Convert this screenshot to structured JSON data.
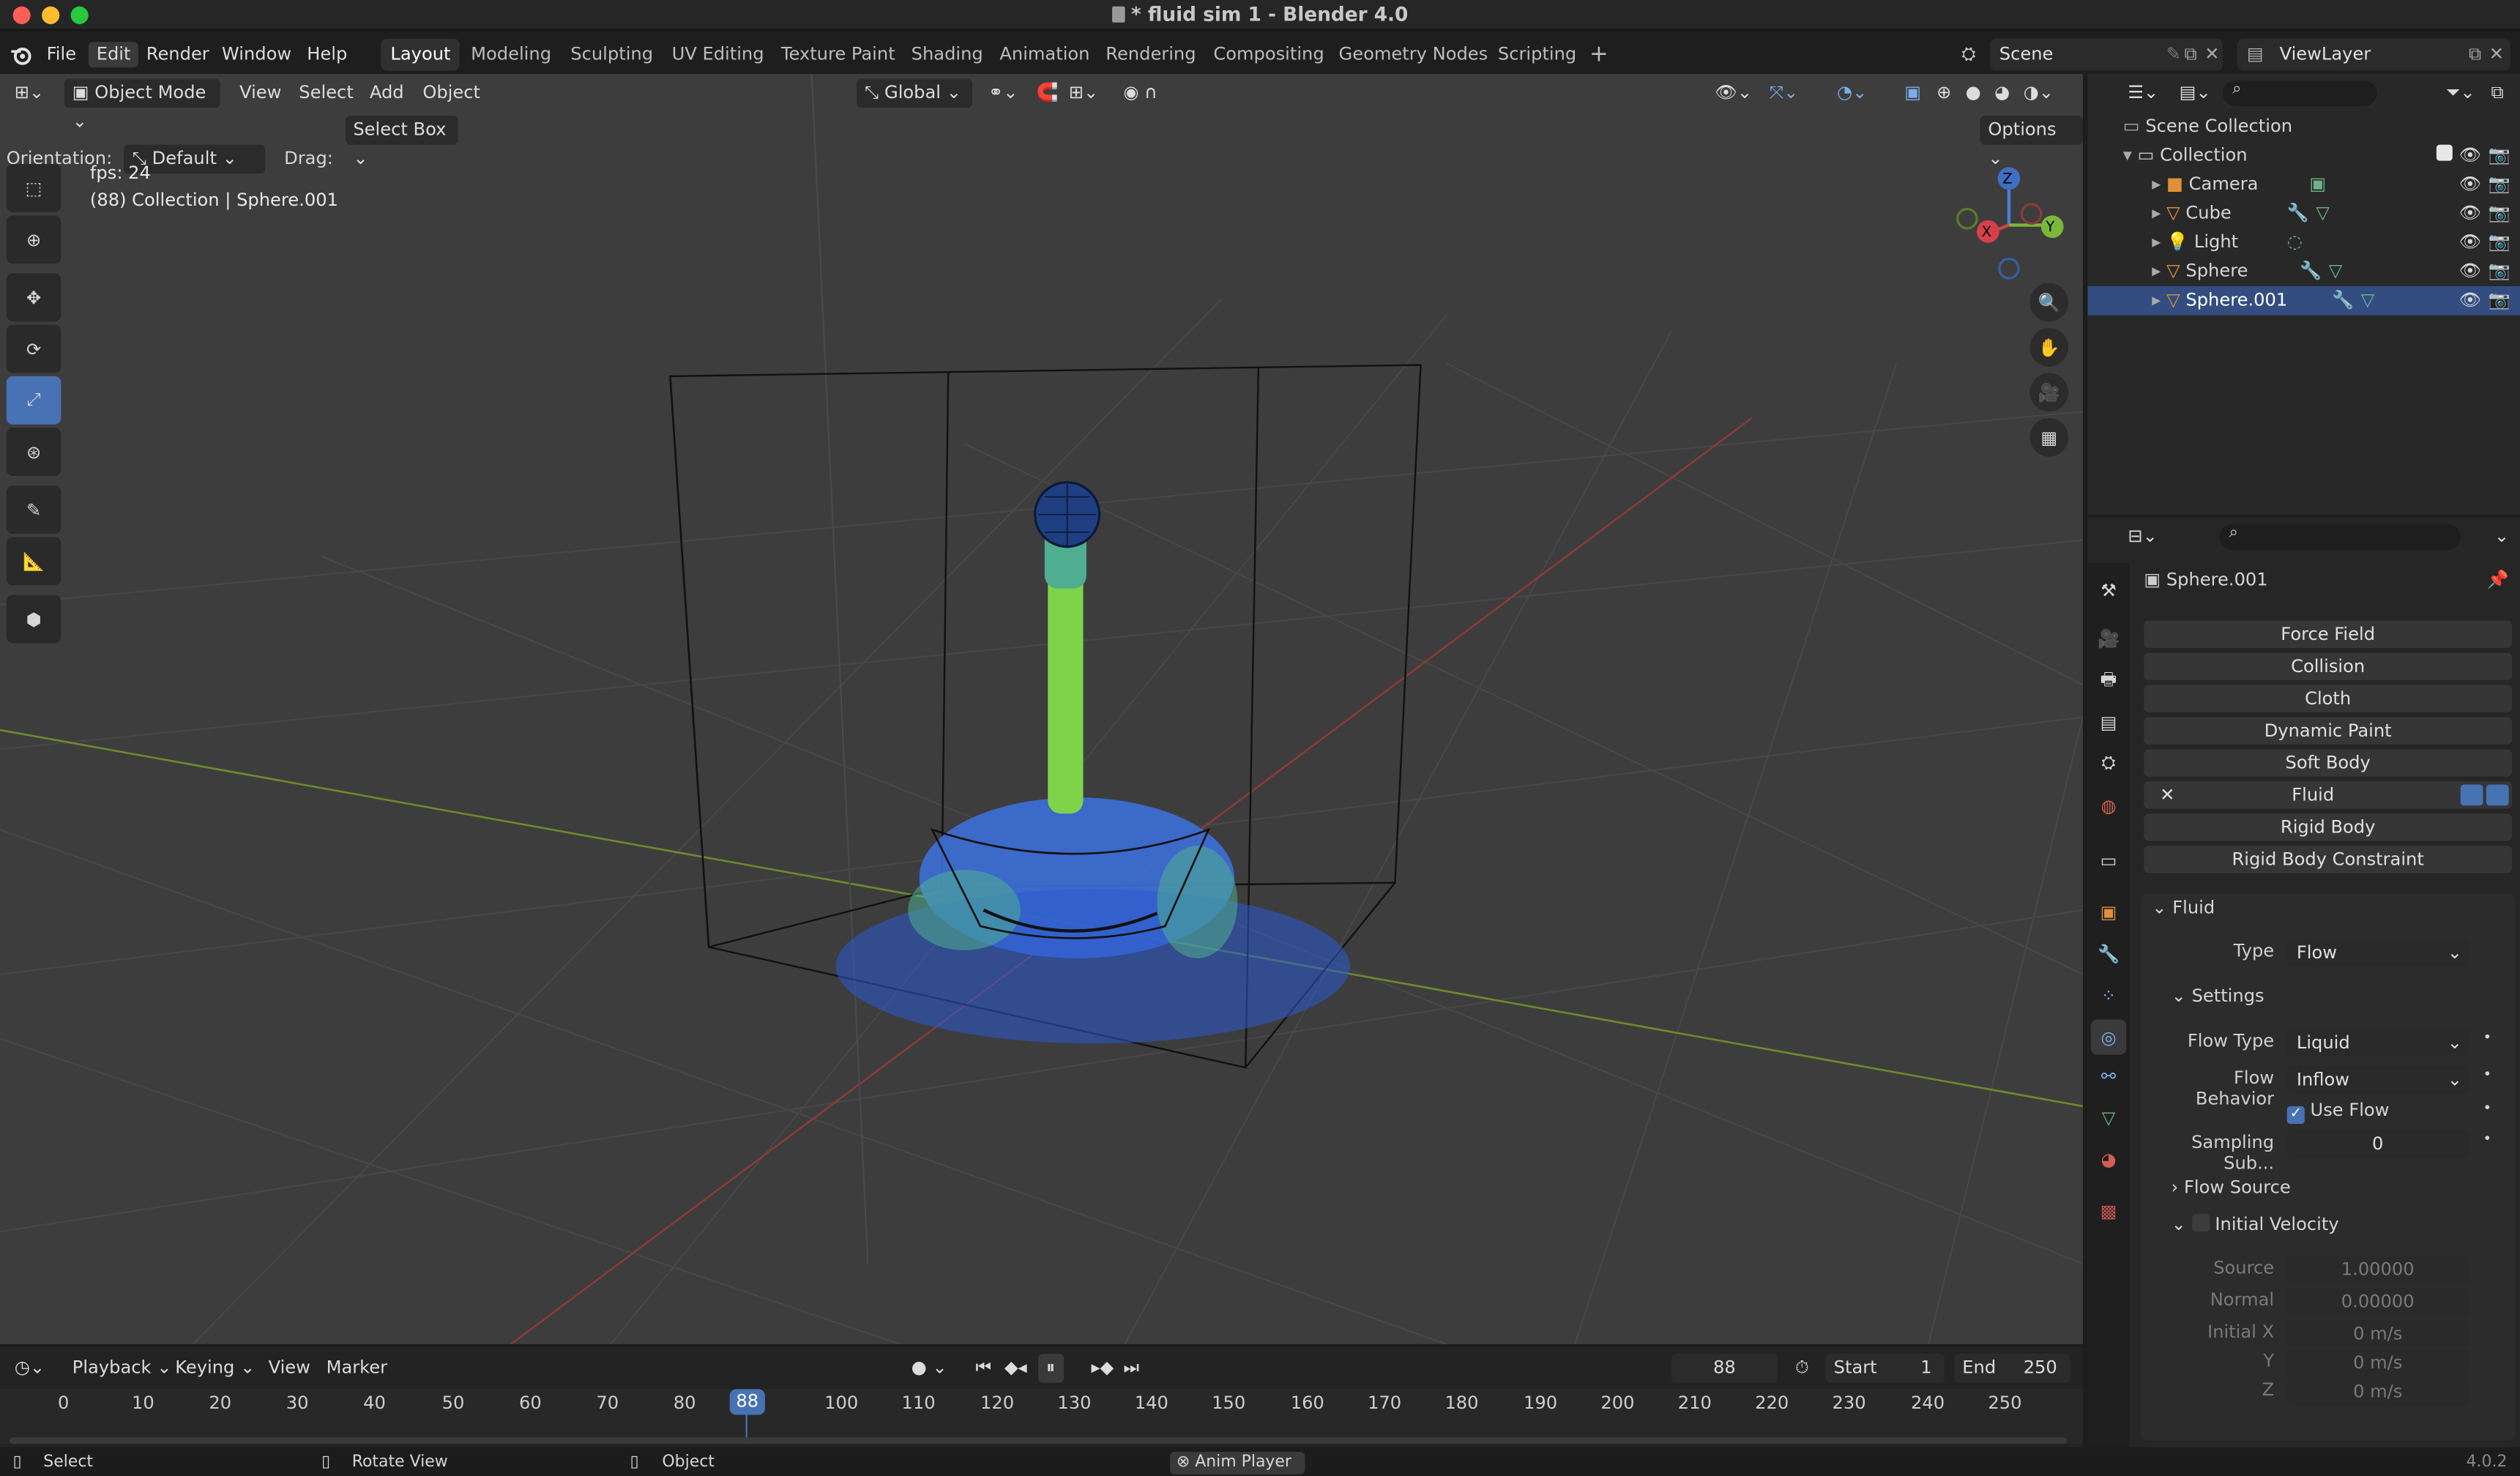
{
  "window": {
    "title": "* fluid sim 1 - Blender 4.0"
  },
  "menu": {
    "items": [
      "File",
      "Edit",
      "Render",
      "Window",
      "Help"
    ]
  },
  "workspaces": [
    "Layout",
    "Modeling",
    "Sculpting",
    "UV Editing",
    "Texture Paint",
    "Shading",
    "Animation",
    "Rendering",
    "Compositing",
    "Geometry Nodes",
    "Scripting"
  ],
  "scene": {
    "name": "Scene",
    "view_layer": "ViewLayer"
  },
  "viewport": {
    "mode": "Object Mode",
    "menus": [
      "View",
      "Select",
      "Add",
      "Object"
    ],
    "transform": "Global",
    "orientation_label": "Orientation:",
    "orientation_value": "Default",
    "drag_label": "Drag:",
    "drag_value": "Select Box",
    "options": "Options",
    "fps": "fps: 24",
    "info": "(88) Collection | Sphere.001",
    "gizmo": {
      "x": "X",
      "y": "Y",
      "z": "Z"
    }
  },
  "outliner": {
    "root": "Scene Collection",
    "collection": "Collection",
    "objects": [
      "Camera",
      "Cube",
      "Light",
      "Sphere",
      "Sphere.001"
    ]
  },
  "properties": {
    "object": "Sphere.001",
    "physics_buttons": [
      "Force Field",
      "Collision",
      "Cloth",
      "Dynamic Paint",
      "Soft Body",
      "Fluid",
      "Rigid Body",
      "Rigid Body Constraint"
    ],
    "fluid": {
      "panel": "Fluid",
      "type_label": "Type",
      "type_value": "Flow",
      "settings": "Settings",
      "flow_type_label": "Flow Type",
      "flow_type_value": "Liquid",
      "flow_behavior_label": "Flow Behavior",
      "flow_behavior_value": "Inflow",
      "use_flow": "Use Flow",
      "sampling_label": "Sampling Sub...",
      "sampling_value": "0",
      "flow_source": "Flow Source",
      "initial_velocity": "Initial Velocity",
      "source_label": "Source",
      "source_value": "1.00000",
      "normal_label": "Normal",
      "normal_value": "0.00000",
      "initx_label": "Initial X",
      "initx_value": "0 m/s",
      "y_label": "Y",
      "y_value": "0 m/s",
      "z_label": "Z",
      "z_value": "0 m/s"
    }
  },
  "timeline": {
    "menus": [
      "Playback",
      "Keying",
      "View",
      "Marker"
    ],
    "current_frame": "88",
    "start_label": "Start",
    "start_value": "1",
    "end_label": "End",
    "end_value": "250",
    "ticks": [
      "0",
      "10",
      "20",
      "30",
      "40",
      "50",
      "60",
      "70",
      "80",
      "100",
      "110",
      "120",
      "130",
      "140",
      "150",
      "160",
      "170",
      "180",
      "190",
      "200",
      "210",
      "220",
      "230",
      "240",
      "250"
    ],
    "playhead": "88"
  },
  "status": {
    "select": "Select",
    "rotate": "Rotate View",
    "object": "Object",
    "anim_player": "Anim Player",
    "version": "4.0.2"
  }
}
